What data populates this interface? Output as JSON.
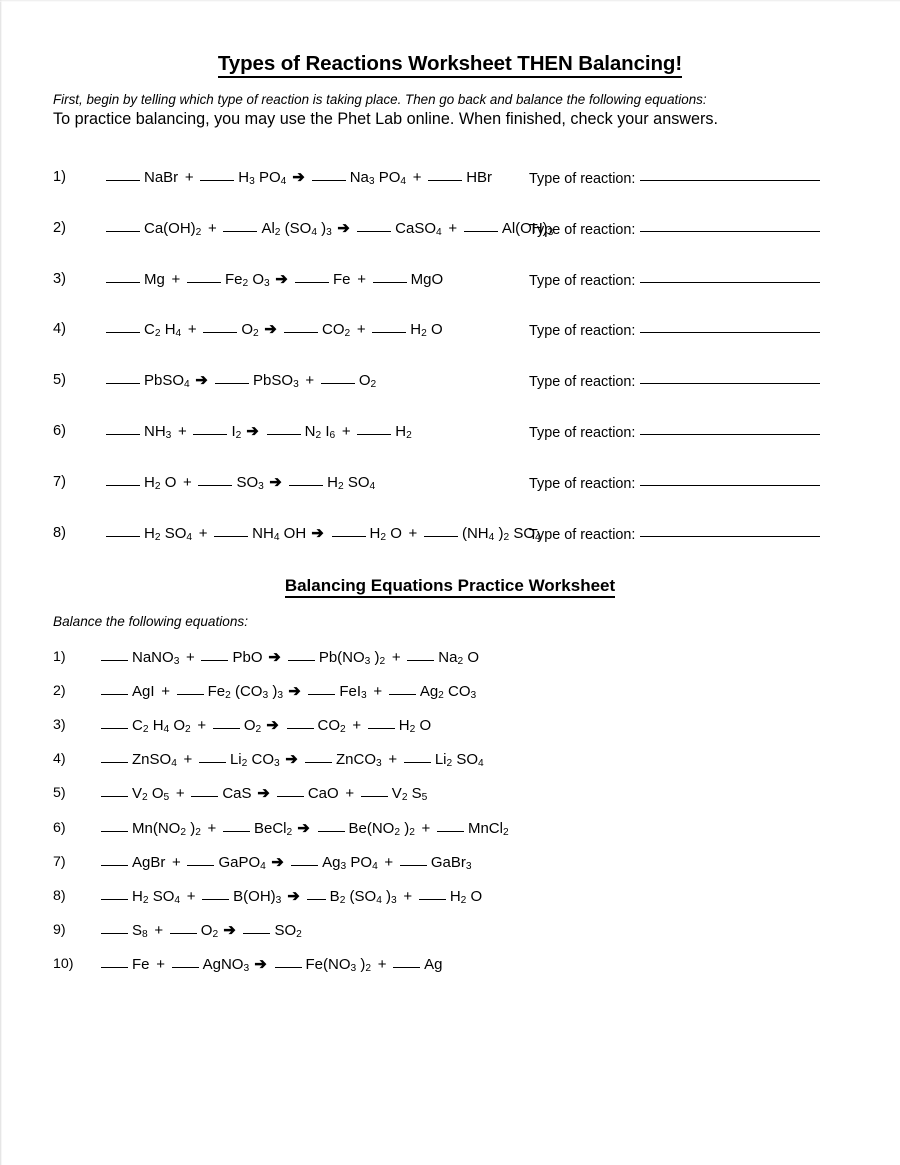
{
  "document": {
    "title": "Types of Reactions Worksheet THEN Balancing!",
    "intro_italic": "First, begin by telling which type of reaction is taking place.  Then go back and balance the following equations:",
    "intro_plain": "To practice balancing, you may use the Phet Lab online.  When finished, check your answers.",
    "arrow_glyph": "➔"
  },
  "section1": {
    "type_of_reaction_label": "Type of reaction:",
    "rows": [
      {
        "number": "1)",
        "parts": [
          {
            "blank": "long"
          },
          {
            "text": "NaBr"
          },
          {
            "op": "+"
          },
          {
            "blank": "long"
          },
          {
            "text": "H",
            "sub": "3"
          },
          {
            "text": "PO",
            "sub": "4"
          },
          {
            "op": "arrow"
          },
          {
            "blank": "long"
          },
          {
            "text": "Na",
            "sub": "3"
          },
          {
            "text": "PO",
            "sub": "4"
          },
          {
            "op": "+"
          },
          {
            "blank": "long"
          },
          {
            "text": "HBr"
          }
        ]
      },
      {
        "number": "2)",
        "parts": [
          {
            "blank": "long"
          },
          {
            "text": "Ca(OH)",
            "sub": "2"
          },
          {
            "op": "+"
          },
          {
            "blank": "long"
          },
          {
            "text": "Al",
            "sub": "2"
          },
          {
            "text": "(SO",
            "sub": "4"
          },
          {
            "text": ")",
            "sub": "3"
          },
          {
            "op": "arrow"
          },
          {
            "blank": "long"
          },
          {
            "text": "CaSO",
            "sub": "4"
          },
          {
            "op": "+"
          },
          {
            "blank": "long"
          },
          {
            "text": "Al(OH)",
            "sub": "3"
          }
        ]
      },
      {
        "number": "3)",
        "parts": [
          {
            "blank": "long"
          },
          {
            "text": "Mg"
          },
          {
            "op": "+"
          },
          {
            "blank": "long"
          },
          {
            "text": "Fe",
            "sub": "2"
          },
          {
            "text": "O",
            "sub": "3"
          },
          {
            "op": "arrow"
          },
          {
            "blank": "long"
          },
          {
            "text": "Fe"
          },
          {
            "op": "+"
          },
          {
            "blank": "long"
          },
          {
            "text": "MgO"
          }
        ]
      },
      {
        "number": "4)",
        "parts": [
          {
            "blank": "long"
          },
          {
            "text": "C",
            "sub": "2"
          },
          {
            "text": "H",
            "sub": "4"
          },
          {
            "op": "+"
          },
          {
            "blank": "long"
          },
          {
            "text": "O",
            "sub": "2"
          },
          {
            "op": "arrow"
          },
          {
            "blank": "long"
          },
          {
            "text": "CO",
            "sub": "2"
          },
          {
            "op": "+"
          },
          {
            "blank": "long"
          },
          {
            "text": "H",
            "sub": "2"
          },
          {
            "text": "O"
          }
        ]
      },
      {
        "number": "5)",
        "parts": [
          {
            "blank": "long"
          },
          {
            "text": "PbSO",
            "sub": "4"
          },
          {
            "op": "arrow"
          },
          {
            "blank": "long"
          },
          {
            "text": "PbSO",
            "sub": "3"
          },
          {
            "op": "+"
          },
          {
            "blank": "long"
          },
          {
            "text": "O",
            "sub": "2"
          }
        ]
      },
      {
        "number": "6)",
        "parts": [
          {
            "blank": "long"
          },
          {
            "text": "NH",
            "sub": "3"
          },
          {
            "op": "+"
          },
          {
            "blank": "long"
          },
          {
            "text": "I",
            "sub": "2"
          },
          {
            "op": "arrow"
          },
          {
            "blank": "long"
          },
          {
            "text": "N",
            "sub": "2"
          },
          {
            "text": "I",
            "sub": "6"
          },
          {
            "op": "+"
          },
          {
            "blank": "long"
          },
          {
            "text": "H",
            "sub": "2"
          }
        ]
      },
      {
        "number": "7)",
        "parts": [
          {
            "blank": "long"
          },
          {
            "text": "H",
            "sub": "2"
          },
          {
            "text": "O"
          },
          {
            "op": "+"
          },
          {
            "blank": "long"
          },
          {
            "text": "SO",
            "sub": "3"
          },
          {
            "op": "arrow"
          },
          {
            "blank": "long"
          },
          {
            "text": "H",
            "sub": "2"
          },
          {
            "text": "SO",
            "sub": "4"
          }
        ]
      },
      {
        "number": "8)",
        "parts": [
          {
            "blank": "long"
          },
          {
            "text": "H",
            "sub": "2"
          },
          {
            "text": "SO",
            "sub": "4"
          },
          {
            "op": "+"
          },
          {
            "blank": "long"
          },
          {
            "text": "NH",
            "sub": "4"
          },
          {
            "text": "OH"
          },
          {
            "op": "arrow"
          },
          {
            "blank": "long"
          },
          {
            "text": "H",
            "sub": "2"
          },
          {
            "text": "O"
          },
          {
            "op": "+"
          },
          {
            "blank": "long"
          },
          {
            "text": "(NH",
            "sub": "4"
          },
          {
            "text": ")",
            "sub": "2"
          },
          {
            "text": "SO",
            "sub": "4"
          }
        ]
      }
    ]
  },
  "section2": {
    "title": "Balancing Equations Practice Worksheet",
    "instruction": "Balance the following equations:",
    "rows": [
      {
        "number": "1)",
        "parts": [
          {
            "blank": "med"
          },
          {
            "text": "NaNO",
            "sub": "3"
          },
          {
            "op": "+"
          },
          {
            "blank": "med"
          },
          {
            "text": "PbO"
          },
          {
            "op": "arrow"
          },
          {
            "blank": "med"
          },
          {
            "text": "Pb(NO",
            "sub": "3"
          },
          {
            "text": ")",
            "sub": "2"
          },
          {
            "op": "+"
          },
          {
            "blank": "med"
          },
          {
            "text": "Na",
            "sub": "2"
          },
          {
            "text": "O"
          }
        ]
      },
      {
        "number": "2)",
        "parts": [
          {
            "blank": "med"
          },
          {
            "text": "AgI"
          },
          {
            "op": "+"
          },
          {
            "blank": "med"
          },
          {
            "text": "Fe",
            "sub": "2"
          },
          {
            "text": "(CO",
            "sub": "3"
          },
          {
            "text": ")",
            "sub": "3"
          },
          {
            "op": "arrow"
          },
          {
            "blank": "med"
          },
          {
            "text": "FeI",
            "sub": "3"
          },
          {
            "op": "+"
          },
          {
            "blank": "med"
          },
          {
            "text": "Ag",
            "sub": "2"
          },
          {
            "text": "CO",
            "sub": "3"
          }
        ]
      },
      {
        "number": "3)",
        "parts": [
          {
            "blank": "med"
          },
          {
            "text": "C",
            "sub": "2"
          },
          {
            "text": "H",
            "sub": "4"
          },
          {
            "text": "O",
            "sub": "2"
          },
          {
            "op": "+"
          },
          {
            "blank": "med"
          },
          {
            "text": "O",
            "sub": "2"
          },
          {
            "op": "arrow"
          },
          {
            "blank": "med"
          },
          {
            "text": "CO",
            "sub": "2"
          },
          {
            "op": "+"
          },
          {
            "blank": "med"
          },
          {
            "text": "H",
            "sub": "2"
          },
          {
            "text": "O"
          }
        ]
      },
      {
        "number": "4)",
        "parts": [
          {
            "blank": "med"
          },
          {
            "text": "ZnSO",
            "sub": "4"
          },
          {
            "op": "+"
          },
          {
            "blank": "med"
          },
          {
            "text": "Li",
            "sub": "2"
          },
          {
            "text": "CO",
            "sub": "3"
          },
          {
            "op": "arrow"
          },
          {
            "blank": "med"
          },
          {
            "text": "ZnCO",
            "sub": "3"
          },
          {
            "op": "+"
          },
          {
            "blank": "med"
          },
          {
            "text": "Li",
            "sub": "2"
          },
          {
            "text": "SO",
            "sub": "4"
          }
        ]
      },
      {
        "number": "5)",
        "parts": [
          {
            "blank": "med"
          },
          {
            "text": "V",
            "sub": "2"
          },
          {
            "text": "O",
            "sub": "5"
          },
          {
            "op": "+"
          },
          {
            "blank": "med"
          },
          {
            "text": "CaS"
          },
          {
            "op": "arrow"
          },
          {
            "blank": "med"
          },
          {
            "text": "CaO"
          },
          {
            "op": "+"
          },
          {
            "blank": "med"
          },
          {
            "text": "V",
            "sub": "2"
          },
          {
            "text": "S",
            "sub": "5"
          }
        ]
      },
      {
        "number": "6)",
        "parts": [
          {
            "blank": "med"
          },
          {
            "text": "Mn(NO",
            "sub": "2"
          },
          {
            "text": ")",
            "sub": "2"
          },
          {
            "op": "+"
          },
          {
            "blank": "med"
          },
          {
            "text": "BeCl",
            "sub": "2"
          },
          {
            "op": "arrow"
          },
          {
            "blank": "med"
          },
          {
            "text": "Be(NO",
            "sub": "2"
          },
          {
            "text": ")",
            "sub": "2"
          },
          {
            "op": "+"
          },
          {
            "blank": "med"
          },
          {
            "text": "MnCl",
            "sub": "2"
          }
        ]
      },
      {
        "number": "7)",
        "parts": [
          {
            "blank": "med"
          },
          {
            "text": "AgBr"
          },
          {
            "op": "+"
          },
          {
            "blank": "med"
          },
          {
            "text": "GaPO",
            "sub": "4"
          },
          {
            "op": "arrow"
          },
          {
            "blank": "med"
          },
          {
            "text": "Ag",
            "sub": "3"
          },
          {
            "text": "PO",
            "sub": "4"
          },
          {
            "op": "+"
          },
          {
            "blank": "med"
          },
          {
            "text": "GaBr",
            "sub": "3"
          }
        ]
      },
      {
        "number": "8)",
        "parts": [
          {
            "blank": "med"
          },
          {
            "text": "H",
            "sub": "2"
          },
          {
            "text": "SO",
            "sub": "4"
          },
          {
            "op": "+"
          },
          {
            "blank": "med"
          },
          {
            "text": "B(OH)",
            "sub": "3"
          },
          {
            "op": "arrow"
          },
          {
            "blank": "short"
          },
          {
            "text": "B",
            "sub": "2"
          },
          {
            "text": "(SO",
            "sub": "4"
          },
          {
            "text": ")",
            "sub": "3"
          },
          {
            "op": "+"
          },
          {
            "blank": "med"
          },
          {
            "text": "H",
            "sub": "2"
          },
          {
            "text": "O"
          }
        ]
      },
      {
        "number": "9)",
        "parts": [
          {
            "blank": "med"
          },
          {
            "text": "S",
            "sub": "8"
          },
          {
            "op": "+"
          },
          {
            "blank": "med"
          },
          {
            "text": "O",
            "sub": "2"
          },
          {
            "op": "arrow"
          },
          {
            "blank": "med"
          },
          {
            "text": "SO",
            "sub": "2"
          }
        ]
      },
      {
        "number": "10)",
        "parts": [
          {
            "blank": "med"
          },
          {
            "text": "Fe"
          },
          {
            "op": "+"
          },
          {
            "blank": "med"
          },
          {
            "text": "AgNO",
            "sub": "3"
          },
          {
            "op": "arrow"
          },
          {
            "blank": "med"
          },
          {
            "text": "Fe(NO",
            "sub": "3"
          },
          {
            "text": ")",
            "sub": "2"
          },
          {
            "op": "+"
          },
          {
            "blank": "med"
          },
          {
            "text": "Ag"
          }
        ]
      }
    ]
  }
}
